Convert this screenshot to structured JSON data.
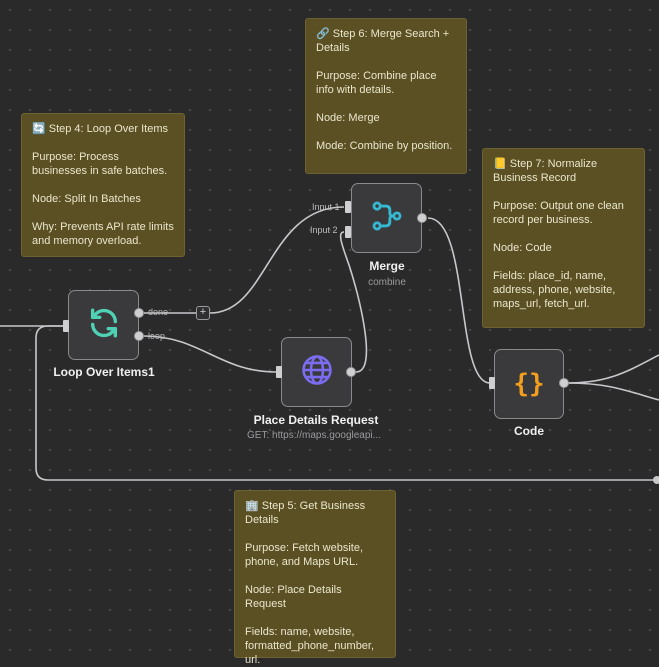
{
  "colors": {
    "canvas": "#2a2a2b",
    "sticky": "#5a5024",
    "wire": "#c8c8cc",
    "loop_icon": "#4fd1b5",
    "merge_icon": "#35b8d0",
    "globe_icon": "#7b6cf0",
    "code_icon": "#f29e1f"
  },
  "stickies": {
    "step4": {
      "icon": "arrows-loop-icon",
      "title": "🔄 Step 4: Loop Over Items",
      "purpose": "Purpose: Process businesses in safe batches.",
      "node": "Node: Split In Batches",
      "why": "Why: Prevents API rate limits and memory overload."
    },
    "step5": {
      "icon": "building-icon",
      "title": "🏢 Step 5: Get Business Details",
      "purpose": "Purpose: Fetch website, phone, and Maps URL.",
      "node": "Node: Place Details Request",
      "fields": "Fields: name, website, formatted_phone_number, url."
    },
    "step6": {
      "icon": "link-icon",
      "title": "🔗 Step 6: Merge Search + Details",
      "purpose": "Purpose: Combine place info with details.",
      "node": "Node: Merge",
      "mode": "Mode: Combine by position."
    },
    "step7": {
      "icon": "ledger-icon",
      "title": "📒 Step 7: Normalize Business Record",
      "purpose": "Purpose: Output one clean record per business.",
      "node": "Node: Code",
      "fields": "Fields: place_id, name, address, phone, website, maps_url, fetch_url."
    }
  },
  "nodes": {
    "loop": {
      "label": "Loop Over Items1",
      "icon": "refresh-icon",
      "out_done": "done",
      "out_loop": "loop"
    },
    "merge": {
      "label": "Merge",
      "subtitle": "combine",
      "icon": "merge-icon",
      "input1": "Input 1",
      "input2": "Input 2"
    },
    "place": {
      "label": "Place Details Request",
      "subtitle": "GET: https://maps.googleapi...",
      "icon": "globe-icon"
    },
    "code": {
      "label": "Code",
      "icon": "curly-braces-icon",
      "glyph": "{}"
    }
  },
  "add_button": "+"
}
